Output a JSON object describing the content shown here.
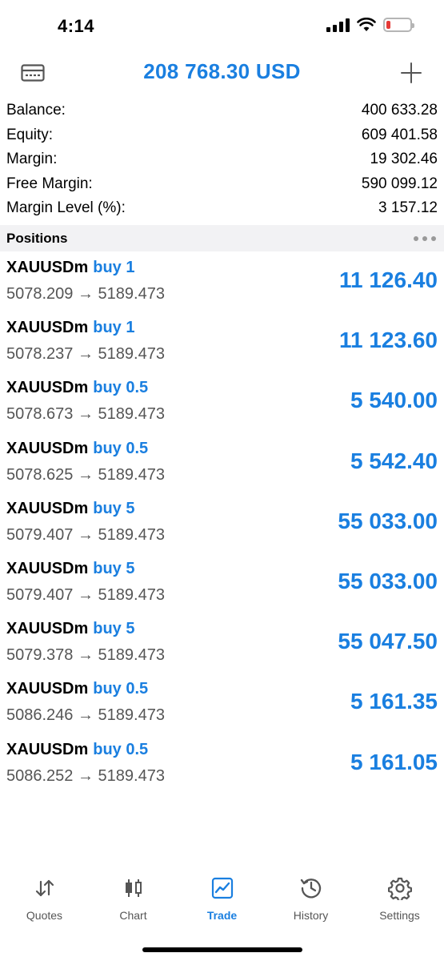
{
  "status_bar": {
    "time": "4:14",
    "battery_color": "#e53935"
  },
  "header": {
    "title": "208 768.30 USD",
    "left_icon": "card-icon",
    "right_icon": "plus-icon",
    "accent_color": "#1a7fe0"
  },
  "summary": [
    {
      "label": "Balance:",
      "value": "400 633.28"
    },
    {
      "label": "Equity:",
      "value": "609 401.58"
    },
    {
      "label": "Margin:",
      "value": "19 302.46"
    },
    {
      "label": "Free Margin:",
      "value": "590 099.12"
    },
    {
      "label": "Margin Level (%):",
      "value": "3 157.12"
    }
  ],
  "positions_header": {
    "title": "Positions",
    "menu_icon": "more-dots-icon"
  },
  "positions": [
    {
      "symbol": "XAUUSDm",
      "direction": "buy 1",
      "prices": "5078.209 → 5189.473",
      "profit": "11 126.40"
    },
    {
      "symbol": "XAUUSDm",
      "direction": "buy 1",
      "prices": "5078.237 → 5189.473",
      "profit": "11 123.60"
    },
    {
      "symbol": "XAUUSDm",
      "direction": "buy 0.5",
      "prices": "5078.673 → 5189.473",
      "profit": "5 540.00"
    },
    {
      "symbol": "XAUUSDm",
      "direction": "buy 0.5",
      "prices": "5078.625 → 5189.473",
      "profit": "5 542.40"
    },
    {
      "symbol": "XAUUSDm",
      "direction": "buy 5",
      "prices": "5079.407 → 5189.473",
      "profit": "55 033.00"
    },
    {
      "symbol": "XAUUSDm",
      "direction": "buy 5",
      "prices": "5079.407 → 5189.473",
      "profit": "55 033.00"
    },
    {
      "symbol": "XAUUSDm",
      "direction": "buy 5",
      "prices": "5079.378 → 5189.473",
      "profit": "55 047.50"
    },
    {
      "symbol": "XAUUSDm",
      "direction": "buy 0.5",
      "prices": "5086.246 → 5189.473",
      "profit": "5 161.35"
    },
    {
      "symbol": "XAUUSDm",
      "direction": "buy 0.5",
      "prices": "5086.252 → 5189.473",
      "profit": "5 161.05"
    }
  ],
  "tabs": [
    {
      "label": "Quotes",
      "icon": "quotes-arrows-icon",
      "active": false
    },
    {
      "label": "Chart",
      "icon": "candlestick-chart-icon",
      "active": false
    },
    {
      "label": "Trade",
      "icon": "trade-line-chart-icon",
      "active": true
    },
    {
      "label": "History",
      "icon": "history-clock-icon",
      "active": false
    },
    {
      "label": "Settings",
      "icon": "gear-icon",
      "active": false
    }
  ]
}
